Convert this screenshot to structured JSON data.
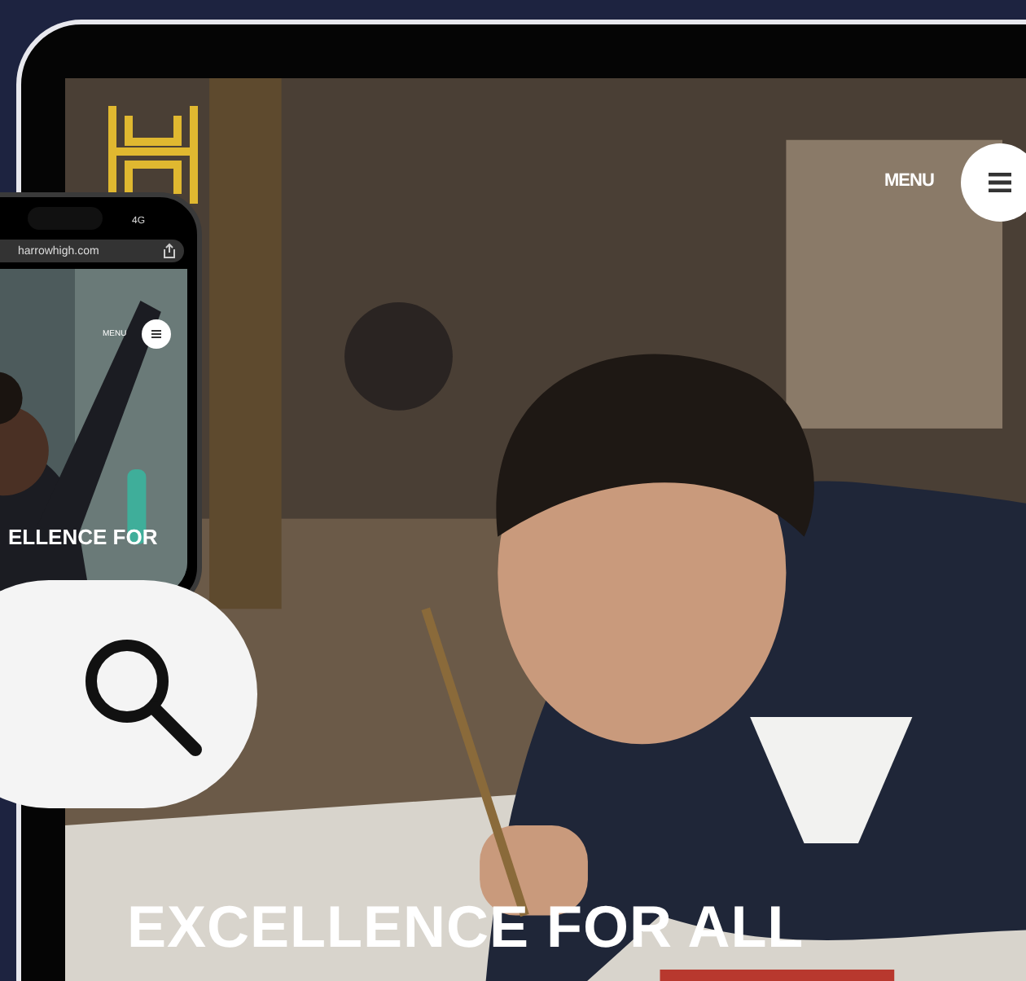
{
  "tablet": {
    "menu_label": "MENU",
    "headline": "EXCELLENCE FOR ALL"
  },
  "phone": {
    "network": "4G",
    "url": "harrowhigh.com",
    "menu_label": "MENU",
    "headline": "ELLENCE FOR"
  }
}
